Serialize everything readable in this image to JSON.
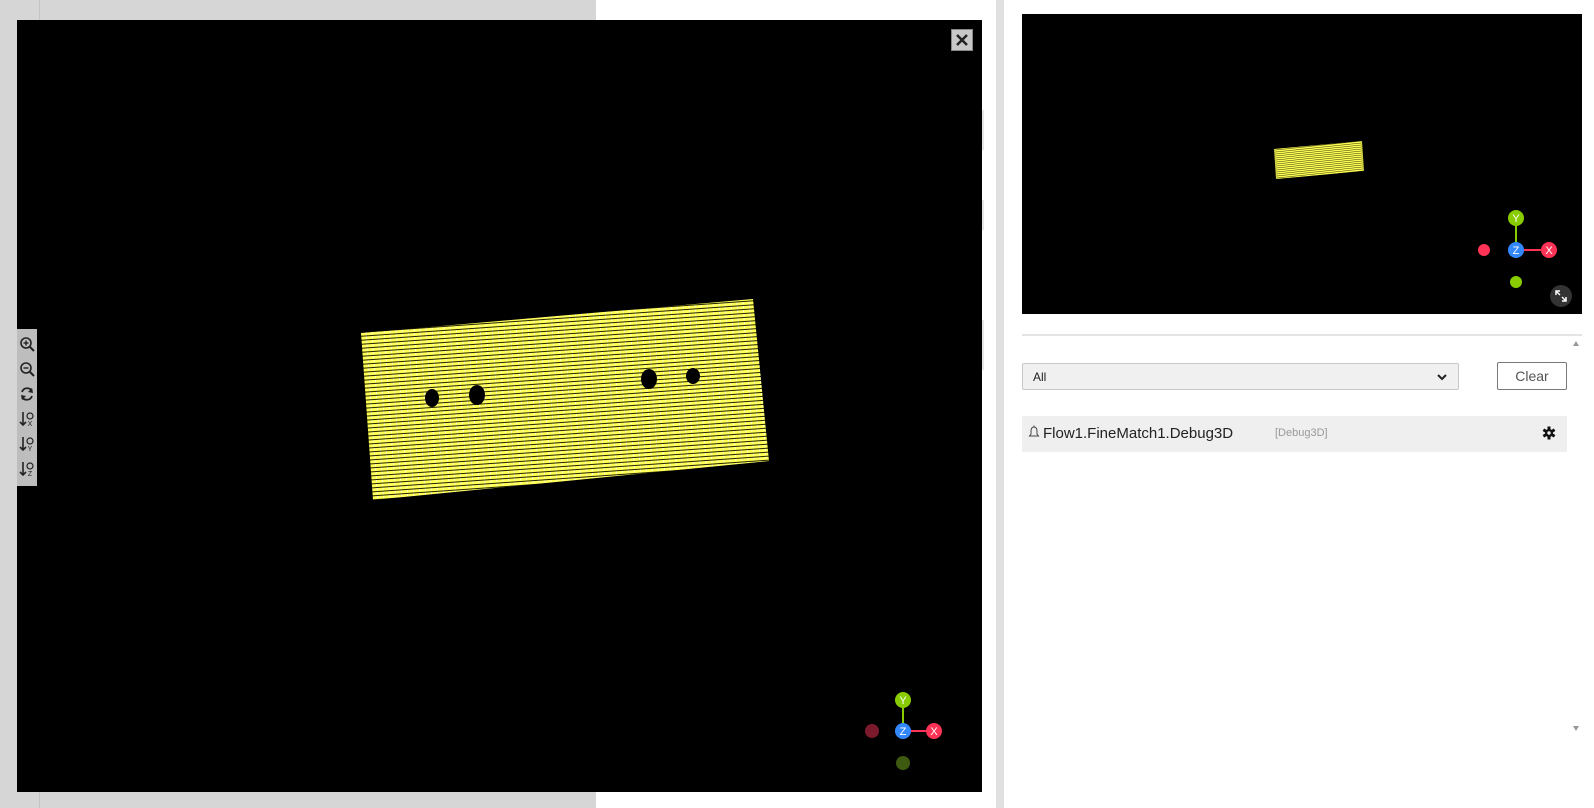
{
  "viewer": {
    "close_icon": "close-icon",
    "toolbar": [
      {
        "name": "zoom-in-icon"
      },
      {
        "name": "zoom-out-icon"
      },
      {
        "name": "reset-view-icon"
      },
      {
        "name": "sort-x-icon",
        "axis": "X"
      },
      {
        "name": "sort-y-icon",
        "axis": "Y"
      },
      {
        "name": "sort-z-icon",
        "axis": "Z"
      }
    ],
    "axes": {
      "x": "X",
      "y": "Y",
      "z": "Z"
    },
    "colors": {
      "background": "#000000",
      "point_cloud": "#ffff44",
      "x_axis": "#ff3355",
      "y_axis": "#88cc00",
      "z_axis": "#3388ff"
    }
  },
  "preview": {
    "axes": {
      "x": "X",
      "y": "Y",
      "z": "Z"
    },
    "expand_icon": "expand-icon"
  },
  "log_panel": {
    "filter": {
      "selected": "All"
    },
    "clear_label": "Clear",
    "items": [
      {
        "name": "Flow1.FineMatch1.Debug3D",
        "type": "[Debug3D]"
      }
    ]
  }
}
